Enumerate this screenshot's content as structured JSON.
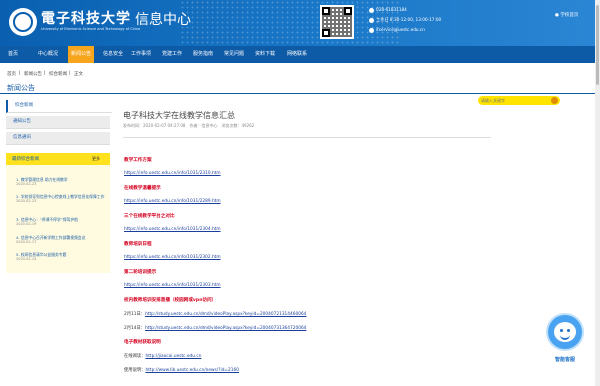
{
  "header": {
    "university_name": "電子科技大学",
    "university_name_en": "University of Electronic Science and Technology of China",
    "site_name": "信息中心",
    "contact": {
      "phone": "028-61831184",
      "workday_line": "工作日 8:30-12:00, 13:00-17:00",
      "email": "itservice@uestc.edu.cn"
    },
    "login_label": "登录",
    "lang_label": "学校首页"
  },
  "nav": {
    "items": [
      "首页",
      "中心概况",
      "新闻公告",
      "信息安全",
      "工作事项",
      "党建工作",
      "服务指南",
      "常见问题",
      "资料下载",
      "网络联系"
    ],
    "active_index": 2
  },
  "search": {
    "placeholder": "请输入关键字"
  },
  "breadcrumb": [
    "首页",
    "新闻公告",
    "综合新闻",
    "正文"
  ],
  "page_title": "新闻公告",
  "sidebar": {
    "tabs": [
      "综合新闻",
      "通知公告",
      "信息通讯"
    ],
    "news_box": {
      "title": "最新综合新闻",
      "more": "更多",
      "items": [
        {
          "title": "1. 教学管理信息 助力在线教学",
          "date": "2020-02-23"
        },
        {
          "title": "2. 学校领导到信息中心检查线上教学信息化保障工作",
          "date": "2020-02-23"
        },
        {
          "title": "3. 信息中心：“停课不停学”保驾护航",
          "date": "2020-02-19"
        },
        {
          "title": "4. 信息中心召开新学期工作部署视频会议",
          "date": "2020-02-17"
        },
        {
          "title": "5. 校网信息清华公益服务专题",
          "date": "2020-02-14"
        }
      ]
    }
  },
  "article": {
    "title": "电子科技大学在线教学信息汇总",
    "meta": "发布时间：2020-02-07 04:27:08　作者：信息中心　浏览次数：49262",
    "sections": [
      {
        "heading": "教学工作方案",
        "link": "https://info.uestc.edu.cn/info/1031/2310.htm"
      },
      {
        "heading": "在线教学温馨提示",
        "link": "https://info.uestc.edu.cn/info/1031/2289.htm"
      },
      {
        "heading": "三个在线教学平台之对比",
        "link": "https://info.uestc.edu.cn/info/1031/2304.htm"
      },
      {
        "heading": "教师培训日程",
        "link": "https://info.uestc.edu.cn/info/1031/2302.htm"
      },
      {
        "heading": "第二轮培训提示",
        "link": "https://info.uestc.edu.cn/info/1031/2303.htm"
      }
    ],
    "platform_heading": "校内教师培训安排直播（校园网或vpn访问）",
    "platform_rows": [
      {
        "label": "2月11日：",
        "link": "http://study.uestc.edu.cn/dmd/videoPlay.aspx?keyid=20040721314460064"
      },
      {
        "label": "2月14日：",
        "link": "http://study.uestc.edu.cn/dmd/videoPlay.aspx?keyid=20040731364720064"
      }
    ],
    "tools_heading": "电子教材获取说明",
    "tools_rows": [
      {
        "label": "在线阅读：",
        "link": "http://jiaocai.uestc.edu.cn"
      },
      {
        "label": "使用说明：",
        "link": "http://www.lib.uestc.edu.cn/news/?id=2160"
      }
    ]
  },
  "service_widget": {
    "label": "智能客服"
  }
}
